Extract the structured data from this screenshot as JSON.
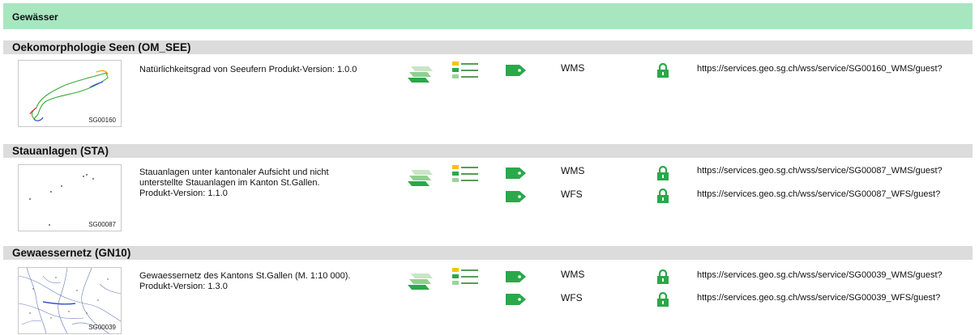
{
  "category": {
    "title": "Gewässer"
  },
  "sections": [
    {
      "title": "Oekomorphologie Seen (OM_SEE)",
      "thumb_code": "SG00160",
      "description": [
        "Natürlichkeitsgrad von Seeufern Produkt-Version: 1.0.0"
      ],
      "services": [
        {
          "type": "WMS",
          "url": "https://services.geo.sg.ch/wss/service/SG00160_WMS/guest?"
        }
      ]
    },
    {
      "title": "Stauanlagen (STA)",
      "thumb_code": "SG00087",
      "description": [
        "Stauanlagen unter kantonaler Aufsicht und nicht",
        "unterstellte Stauanlagen im Kanton St.Gallen.",
        "Produkt-Version: 1.1.0"
      ],
      "services": [
        {
          "type": "WMS",
          "url": "https://services.geo.sg.ch/wss/service/SG00087_WMS/guest?"
        },
        {
          "type": "WFS",
          "url": "https://services.geo.sg.ch/wss/service/SG00087_WFS/guest?"
        }
      ]
    },
    {
      "title": "Gewaessernetz (GN10)",
      "thumb_code": "SG00039",
      "description": [
        "Gewaessernetz des Kantons St.Gallen (M. 1:10 000).",
        "Produkt-Version: 1.3.0"
      ],
      "services": [
        {
          "type": "WMS",
          "url": "https://services.geo.sg.ch/wss/service/SG00039_WMS/guest?"
        },
        {
          "type": "WFS",
          "url": "https://services.geo.sg.ch/wss/service/SG00039_WFS/guest?"
        }
      ]
    }
  ],
  "icons": {
    "layers": "layers-icon",
    "legend": "legend-icon",
    "tag": "tag-icon",
    "lock": "lock-icon"
  },
  "colors": {
    "category_bg": "#a8e6bf",
    "section_bg": "#dcdcdc",
    "icon_green": "#2aa84a"
  }
}
